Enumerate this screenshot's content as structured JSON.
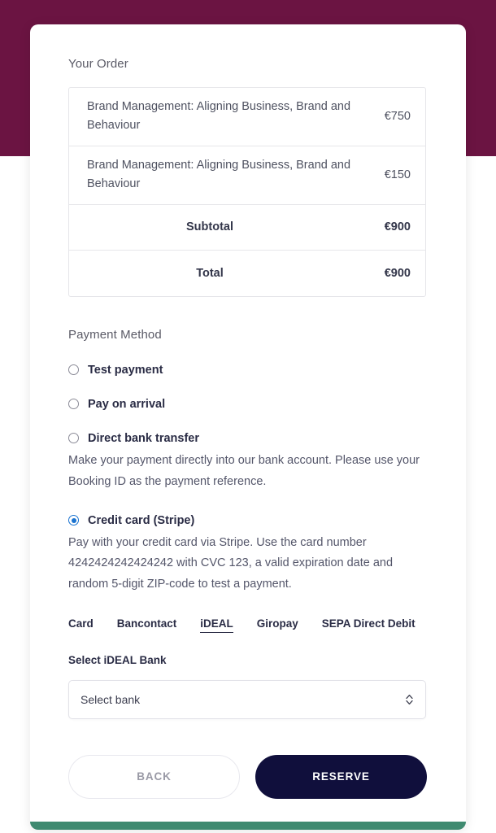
{
  "theme": {
    "header_band_color": "#6b1442",
    "card_accent_color": "#3f8a70",
    "primary_button_color": "#100f3c",
    "radio_selected_color": "#1a73d0"
  },
  "order": {
    "heading": "Your Order",
    "items": [
      {
        "name": "Brand Management: Aligning Business, Brand and Behaviour",
        "price": "€750"
      },
      {
        "name": "Brand Management: Aligning Business, Brand and Behaviour",
        "price": "€150"
      }
    ],
    "summary": [
      {
        "label": "Subtotal",
        "value": "€900"
      },
      {
        "label": "Total",
        "value": "€900"
      }
    ]
  },
  "payment": {
    "heading": "Payment Method",
    "options": [
      {
        "label": "Test payment",
        "selected": false,
        "description": ""
      },
      {
        "label": "Pay on arrival",
        "selected": false,
        "description": ""
      },
      {
        "label": "Direct bank transfer",
        "selected": false,
        "description": "Make your payment directly into our bank account. Please use your Booking ID as the payment reference."
      },
      {
        "label": "Credit card (Stripe)",
        "selected": true,
        "description": "Pay with your credit card via Stripe. Use the card number 4242424242424242 with CVC 123, a valid expiration date and random 5-digit ZIP-code to test a payment."
      }
    ],
    "stripe_tabs": [
      {
        "label": "Card",
        "active": false
      },
      {
        "label": "Bancontact",
        "active": false
      },
      {
        "label": "iDEAL",
        "active": true
      },
      {
        "label": "Giropay",
        "active": false
      },
      {
        "label": "SEPA Direct Debit",
        "active": false
      }
    ],
    "bank_select": {
      "label": "Select iDEAL Bank",
      "value": "Select bank",
      "placeholder": "Select bank"
    }
  },
  "footer": {
    "back_label": "BACK",
    "reserve_label": "RESERVE"
  }
}
